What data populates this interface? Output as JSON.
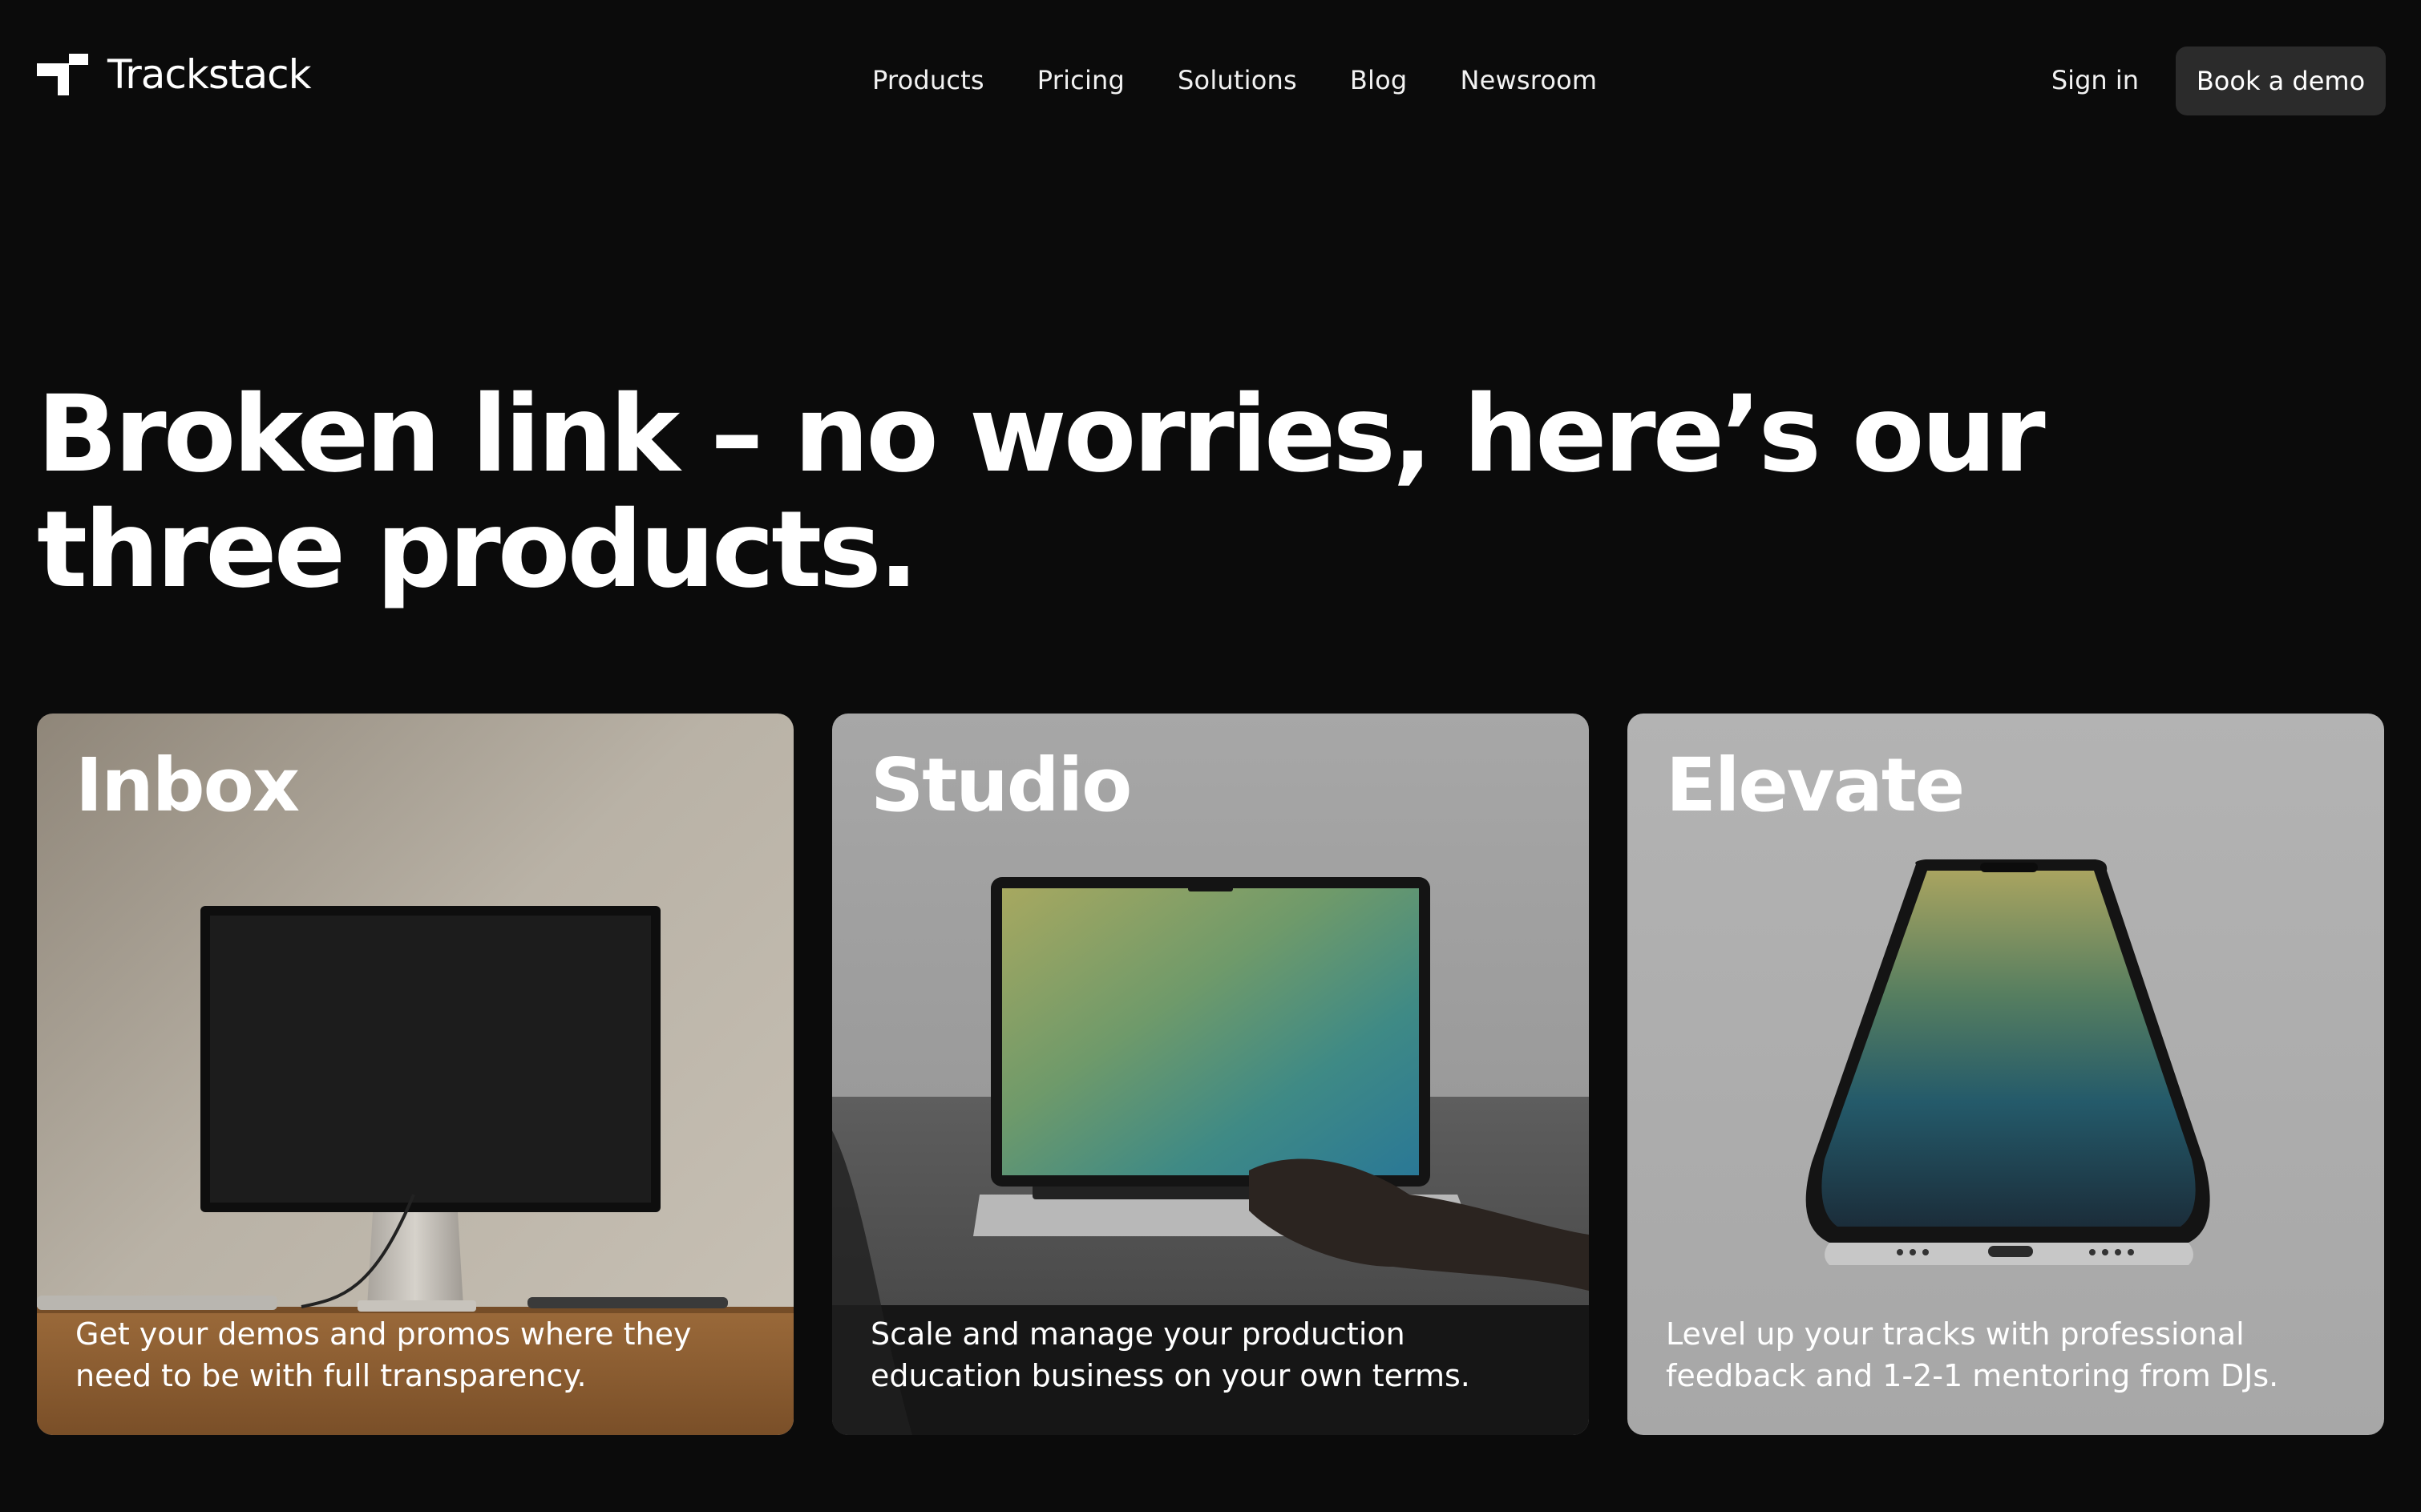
{
  "header": {
    "brand": "Trackstack",
    "nav": [
      "Products",
      "Pricing",
      "Solutions",
      "Blog",
      "Newsroom"
    ],
    "sign_in": "Sign in",
    "cta": "Book a demo"
  },
  "hero": {
    "headline": "Broken link – no worries, here’s our three products."
  },
  "products": [
    {
      "title": "Inbox",
      "description": "Get your demos and promos where they need to be with full transparency.",
      "image": "desktop-monitor"
    },
    {
      "title": "Studio",
      "description": "Scale and manage your production education business on your own terms.",
      "image": "laptop"
    },
    {
      "title": "Elevate",
      "description": "Level up your tracks with professional feedback and 1-2-1 mentoring from DJs.",
      "image": "smartphone"
    }
  ],
  "colors": {
    "background": "#0b0b0b",
    "button": "#2b2b2b",
    "text": "#ffffff"
  }
}
